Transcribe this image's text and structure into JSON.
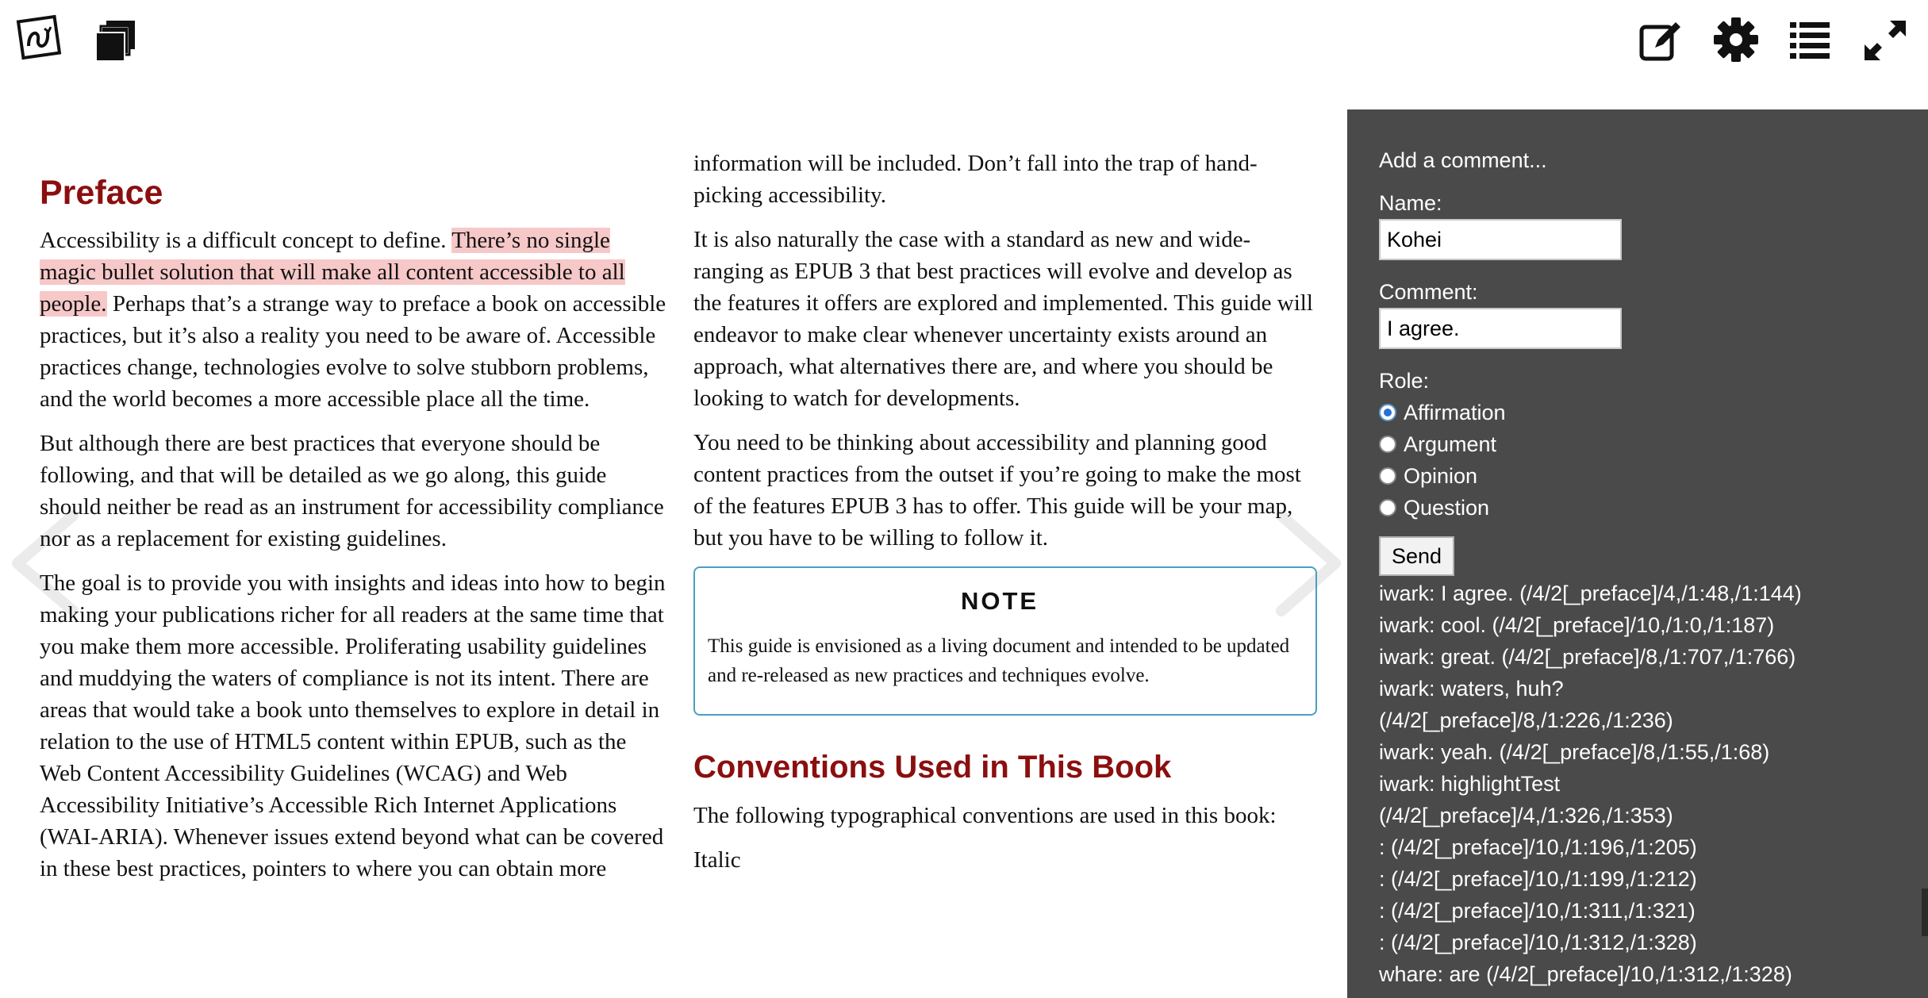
{
  "toolbar": {
    "left_icons": [
      "reader-logo-icon",
      "library-icon"
    ],
    "right_icons": [
      "annotate-icon",
      "settings-icon",
      "toc-icon",
      "fullscreen-icon"
    ]
  },
  "book": {
    "preface_title": "Preface",
    "p1_before": "Accessibility is a difficult concept to define. ",
    "p1_highlight": "There’s no single magic bullet solution that will make all content accessible to all people.",
    "p1_after": " Perhaps that’s a strange way to preface a book on accessible practices, but it’s also a reality you need to be aware of. Accessible practices change, technologies evolve to solve stubborn problems, and the world becomes a more accessible place all the time.",
    "p2": "But although there are best practices that everyone should be following, and that will be detailed as we go along, this guide should neither be read as an instrument for accessibility compliance nor as a replacement for existing guidelines.",
    "p3": "The goal is to provide you with insights and ideas into how to begin making your publications richer for all readers at the same time that you make them more accessible. Proliferating usability guidelines and muddying the waters of compliance is not its intent. There are areas that would take a book unto themselves to explore in detail in relation to the use of HTML5 content within EPUB, such as the Web Content Accessibility Guidelines (WCAG) and Web Accessibility Initiative’s Accessible Rich Internet Applications (WAI-ARIA). Whenever issues extend beyond what can be covered in these best practices, pointers to where you can obtain more",
    "p3_cont": "information will be included. Don’t fall into the trap of hand-picking accessibility.",
    "p4": "It is also naturally the case with a standard as new and wide-ranging as EPUB 3 that best practices will evolve and develop as the features it offers are explored and implemented. This guide will endeavor to make clear whenever uncertainty exists around an approach, what alternatives there are, and where you should be looking to watch for developments.",
    "p5": "You need to be thinking about accessibility and planning good content practices from the outset if you’re going to make the most of the features EPUB 3 has to offer. This guide will be your map, but you have to be willing to follow it.",
    "note_title": "NOTE",
    "note_text": "This guide is envisioned as a living document and intended to be updated and re-released as new practices and techniques evolve.",
    "conventions_title": "Conventions Used in This Book",
    "p6": "The following typographical conventions are used in this book:",
    "italic_term": "Italic"
  },
  "panel": {
    "heading": "Add a comment...",
    "name_label": "Name:",
    "name_value": "Kohei",
    "comment_label": "Comment:",
    "comment_value": "I agree.",
    "role_label": "Role:",
    "roles": [
      "Affirmation",
      "Argument",
      "Opinion",
      "Question"
    ],
    "selected_role": "Affirmation",
    "send_label": "Send",
    "comments": [
      "iwark: I agree. (/4/2[_preface]/4,/1:48,/1:144)",
      "iwark: cool. (/4/2[_preface]/10,/1:0,/1:187)",
      "iwark: great. (/4/2[_preface]/8,/1:707,/1:766)",
      "iwark: waters, huh?",
      "(/4/2[_preface]/8,/1:226,/1:236)",
      "iwark: yeah. (/4/2[_preface]/8,/1:55,/1:68)",
      "iwark: highlightTest",
      "(/4/2[_preface]/4,/1:326,/1:353)",
      ": (/4/2[_preface]/10,/1:196,/1:205)",
      ": (/4/2[_preface]/10,/1:199,/1:212)",
      ": (/4/2[_preface]/10,/1:311,/1:321)",
      ": (/4/2[_preface]/10,/1:312,/1:328)",
      "whare: are (/4/2[_preface]/10,/1:312,/1:328)"
    ]
  },
  "colors": {
    "heading": "#8b0f0f",
    "highlight": "#f7c8c8",
    "panel_bg": "#4a4a4a",
    "note_border": "#4aa0c0"
  }
}
